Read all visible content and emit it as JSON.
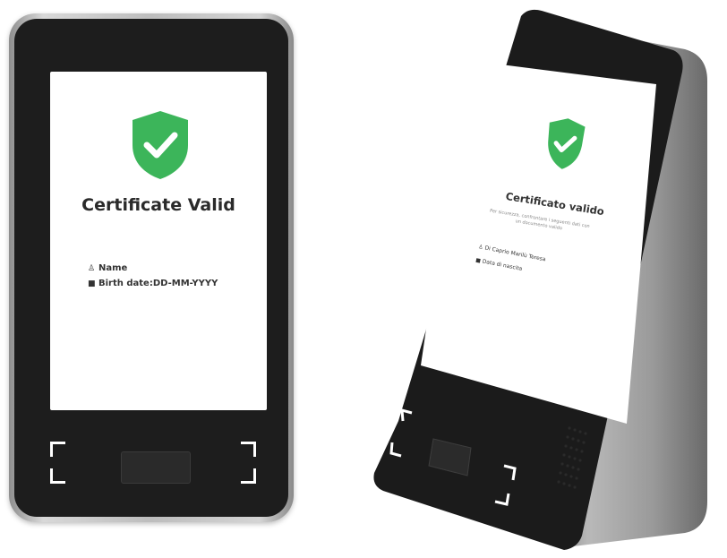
{
  "front_device": {
    "title": "Certificate Valid",
    "name_label": "Name",
    "birth_label": "Birth date:DD-MM-YYYY"
  },
  "angled_device": {
    "title": "Certificato valido",
    "subtitle": "Per sicurezza, confrontare i seguenti dati con un documento valido",
    "name_value": "Di Caprio Marilù Teresa",
    "birth_label": "Data di nascita"
  },
  "colors": {
    "shield_green": "#3cb55a",
    "bezel": "#1d1d1d",
    "frame_silver": "#c8c8c8"
  }
}
